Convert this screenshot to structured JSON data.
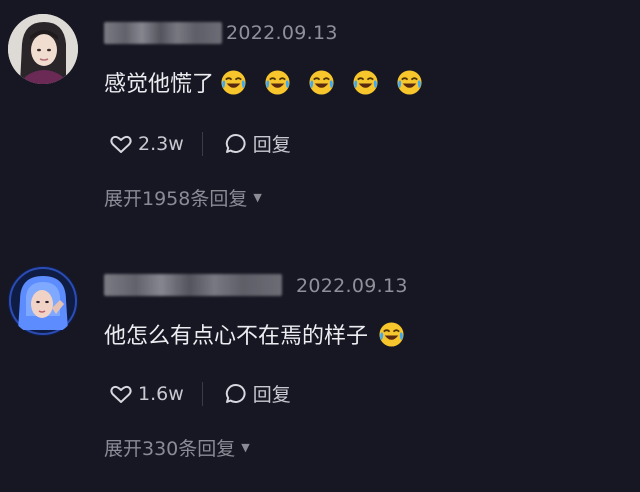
{
  "comments": [
    {
      "date": "2022.09.13",
      "text": "感觉他慌了",
      "emojis": [
        "rolling-laughing-emoji",
        "rolling-laughing-emoji",
        "rolling-laughing-emoji",
        "rolling-laughing-emoji",
        "rolling-laughing-emoji"
      ],
      "likes": "2.3w",
      "reply_label": "回复",
      "expand_label": "展开1958条回复"
    },
    {
      "date": "2022.09.13",
      "text": "他怎么有点心不在焉的样子",
      "emojis": [
        "rolling-laughing-emoji"
      ],
      "likes": "1.6w",
      "reply_label": "回复",
      "expand_label": "展开330条回复"
    }
  ],
  "colors": {
    "background": "#161722",
    "primary_text": "#ececf1",
    "secondary_text": "#8f909a",
    "emoji_face": "#f7c52c",
    "emoji_tears": "#3fa9f5"
  }
}
